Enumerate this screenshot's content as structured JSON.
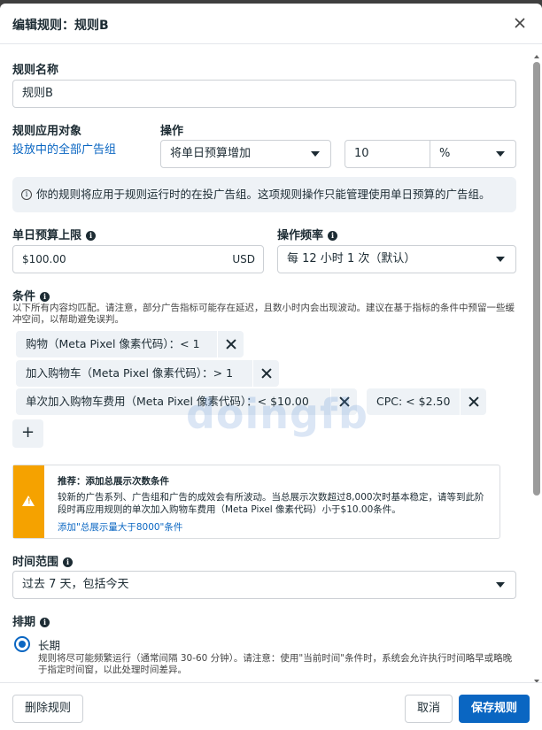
{
  "dialog": {
    "title": "编辑规则：规则B"
  },
  "rule_name": {
    "label": "规则名称",
    "value": "规则B"
  },
  "apply_to": {
    "label": "规则应用对象",
    "link": "投放中的全部广告组"
  },
  "action": {
    "label": "操作",
    "select": "将单日预算增加",
    "amount": "10",
    "unit": "%"
  },
  "notice": "你的规则将应用于规则运行时的在投广告组。这项规则操作只能管理使用单日预算的广告组。",
  "budget_cap": {
    "label": "单日预算上限",
    "value": "$100.00",
    "currency": "USD"
  },
  "frequency": {
    "label": "操作频率",
    "value": "每 12 小时 1 次（默认）"
  },
  "conditions": {
    "label": "条件",
    "note": "以下所有内容均匹配。请注意，部分广告指标可能存在延迟，且数小时内会出现波动。建议在基于指标的条件中预留一些缓冲空间，以帮助避免误判。",
    "items": [
      {
        "text": "购物（Meta Pixel 像素代码）：< 1"
      },
      {
        "text": "加入购物车（Meta Pixel 像素代码）：> 1"
      },
      {
        "text": "单次加入购物车费用（Meta Pixel 像素代码）：< $10.00"
      },
      {
        "text": "CPC: < $2.50"
      }
    ],
    "add_label": "+"
  },
  "recommendation": {
    "head": "推荐：添加总展示次数条件",
    "text": "较新的广告系列、广告组和广告的成效会有所波动。当总展示次数超过8,000次时基本稳定，请等到此阶段时再应用规则的单次加入购物车费用（Meta Pixel 像素代码）小于$10.00条件。",
    "link": "添加\"总展示量大于8000\"条件"
  },
  "time_range": {
    "label": "时间范围",
    "value": "过去 7 天，包括今天"
  },
  "schedule": {
    "label": "排期",
    "option_label": "长期",
    "option_desc": "规则将尽可能频繁运行（通常间隔 30-60 分钟）。请注意：使用\"当前时间\"条件时，系统会允许执行时间略早或略晚于指定时间窗，以此处理时间差异。"
  },
  "footer": {
    "delete": "删除规则",
    "cancel": "取消",
    "save": "保存规则"
  },
  "watermark": "doingfb",
  "colors": {
    "primary": "#0a66c2",
    "warning": "#f5a200",
    "chip_bg": "#eef2f6"
  }
}
